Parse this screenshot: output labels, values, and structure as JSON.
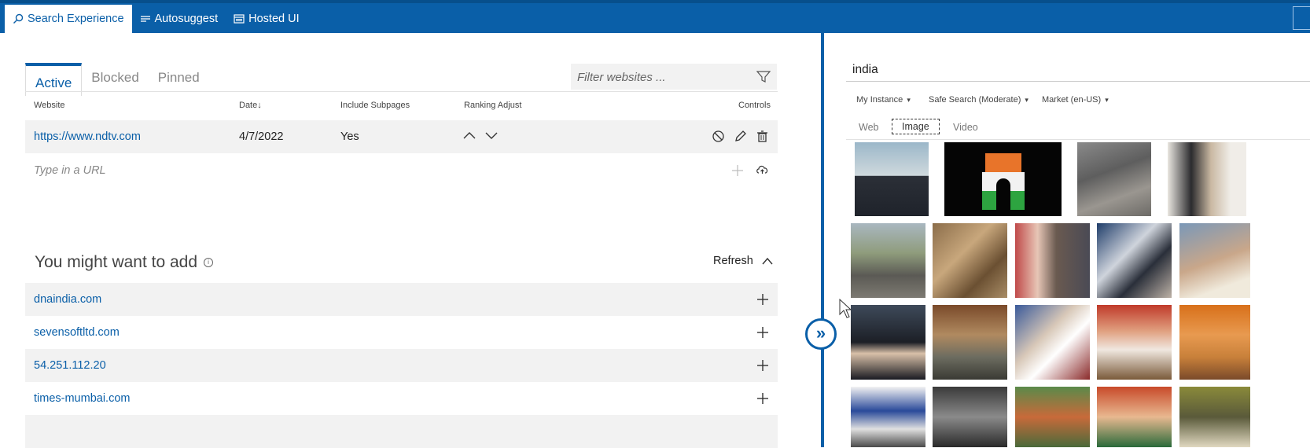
{
  "topnav": {
    "tabs": [
      {
        "label": "Search Experience",
        "icon": "search-icon"
      },
      {
        "label": "Autosuggest",
        "icon": "list-icon"
      },
      {
        "label": "Hosted UI",
        "icon": "window-icon"
      }
    ]
  },
  "left": {
    "tabs": [
      "Active",
      "Blocked",
      "Pinned"
    ],
    "filter_placeholder": "Filter websites ...",
    "columns": {
      "website": "Website",
      "date": "Date↓",
      "include_subpages": "Include Subpages",
      "ranking_adjust": "Ranking Adjust",
      "controls": "Controls"
    },
    "rows": [
      {
        "website": "https://www.ndtv.com",
        "date": "4/7/2022",
        "include_subpages": "Yes"
      }
    ],
    "url_placeholder": "Type in a URL",
    "suggestions": {
      "title": "You might want to add",
      "refresh": "Refresh",
      "items": [
        "dnaindia.com",
        "sevensoftltd.com",
        "54.251.112.20",
        "times-mumbai.com"
      ]
    }
  },
  "right": {
    "query": "india",
    "dropdowns": [
      "My Instance",
      "Safe Search (Moderate)",
      "Market (en-US)"
    ],
    "tabs": [
      "Web",
      "Image",
      "Video"
    ],
    "active_tab": "Image"
  },
  "colors": {
    "brand": "#0a5fa8",
    "row_bg": "#f2f2f2"
  }
}
